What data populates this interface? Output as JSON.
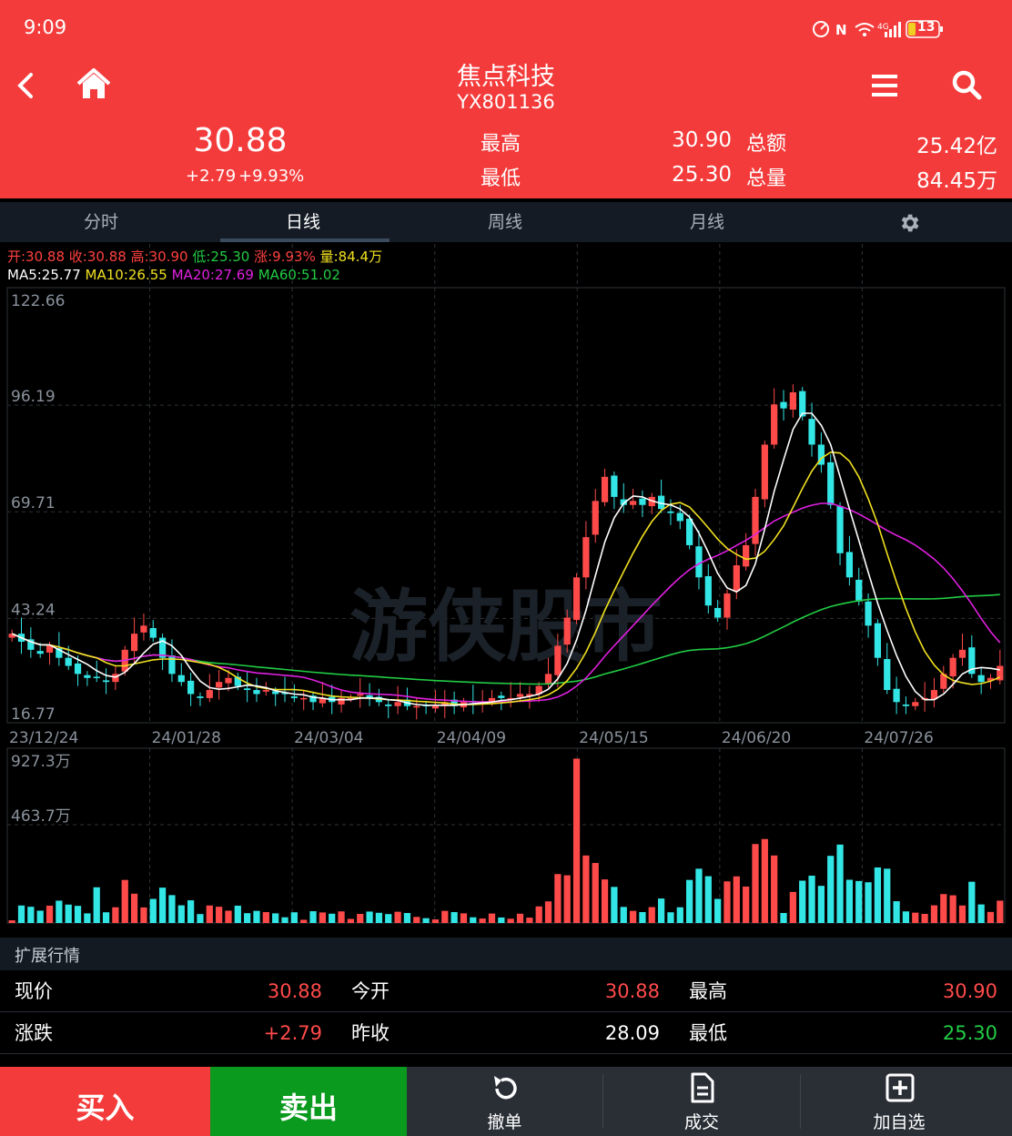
{
  "status_bar": {
    "time": "9:09",
    "battery": "13",
    "network": "4G"
  },
  "header": {
    "title": "焦点科技",
    "code": "YX801136"
  },
  "quote": {
    "price": "30.88",
    "change": "+2.79",
    "change_pct": "+9.93%",
    "high_label": "最高",
    "high": "30.90",
    "low_label": "最低",
    "low": "25.30",
    "amount_label": "总额",
    "amount": "25.42亿",
    "volume_label": "总量",
    "volume": "84.45万"
  },
  "tabs": [
    {
      "label": "分时",
      "active": false
    },
    {
      "label": "日线",
      "active": true
    },
    {
      "label": "周线",
      "active": false
    },
    {
      "label": "月线",
      "active": false
    }
  ],
  "legend": {
    "ohlc": [
      {
        "text": "开:30.88",
        "color": "#ff4040"
      },
      {
        "text": "收:30.88",
        "color": "#ff4040"
      },
      {
        "text": "高:30.90",
        "color": "#ff4040"
      },
      {
        "text": "低:25.30",
        "color": "#22cc44"
      },
      {
        "text": "涨:9.93%",
        "color": "#ff4040"
      },
      {
        "text": "量:84.4万",
        "color": "#f0e020"
      }
    ],
    "ma": [
      {
        "text": "MA5:25.77",
        "color": "#ffffff"
      },
      {
        "text": "MA10:26.55",
        "color": "#f0e020"
      },
      {
        "text": "MA20:27.69",
        "color": "#e020e0"
      },
      {
        "text": "MA60:51.02",
        "color": "#22cc44"
      }
    ]
  },
  "watermark": "游侠股市",
  "chart_data": {
    "type": "candlestick",
    "price_axis": [
      "122.66",
      "96.19",
      "69.71",
      "43.24",
      "16.77"
    ],
    "ylim": [
      16.77,
      122.66
    ],
    "dates": [
      "23/12/24",
      "24/01/28",
      "24/03/04",
      "24/04/09",
      "24/05/15",
      "24/06/20",
      "24/07/26"
    ],
    "volume_axis": [
      "927.3万",
      "463.7万"
    ],
    "volume_max": 927.3,
    "close": [
      38,
      36,
      34,
      33,
      35,
      32,
      30,
      28,
      27,
      27,
      26,
      28,
      34,
      38,
      40,
      37,
      32,
      28,
      26,
      23,
      22,
      24,
      26,
      27,
      25,
      24,
      23,
      24,
      23,
      23,
      22,
      22,
      21,
      22,
      21,
      22,
      22,
      23,
      22,
      21,
      20,
      21,
      20,
      20,
      20,
      20,
      21,
      20,
      21,
      21,
      21,
      22,
      22,
      22,
      23,
      23,
      25,
      28,
      35,
      42,
      52,
      62,
      71,
      77,
      72,
      70,
      71,
      70,
      72,
      69,
      68,
      66,
      60,
      52,
      45,
      42,
      48,
      55,
      60,
      72,
      85,
      95,
      94,
      98,
      92,
      85,
      80,
      70,
      58,
      52,
      46,
      40,
      32,
      24,
      21,
      20,
      21,
      22,
      24,
      28,
      32,
      34,
      28,
      26,
      27,
      30
    ],
    "colors": {
      "up": "#ff4a4a",
      "down": "#33e6e6",
      "ma5": "#ffffff",
      "ma10": "#f0e020",
      "ma20": "#e020e0",
      "ma60": "#22cc44"
    }
  },
  "extended": {
    "title": "扩展行情",
    "rows": [
      [
        {
          "label": "现价",
          "value": "30.88",
          "color": "#ff4a4a"
        },
        {
          "label": "今开",
          "value": "30.88",
          "color": "#ff4a4a"
        },
        {
          "label": "最高",
          "value": "30.90",
          "color": "#ff4a4a"
        }
      ],
      [
        {
          "label": "涨跌",
          "value": "+2.79",
          "color": "#ff4a4a"
        },
        {
          "label": "昨收",
          "value": "28.09",
          "color": "#ffffff"
        },
        {
          "label": "最低",
          "value": "25.30",
          "color": "#22cc44"
        }
      ]
    ]
  },
  "bottom": {
    "buy": "买入",
    "sell": "卖出",
    "actions": [
      {
        "label": "撤单",
        "icon": "undo-icon"
      },
      {
        "label": "成交",
        "icon": "document-icon"
      },
      {
        "label": "加自选",
        "icon": "add-watchlist-icon"
      }
    ]
  }
}
